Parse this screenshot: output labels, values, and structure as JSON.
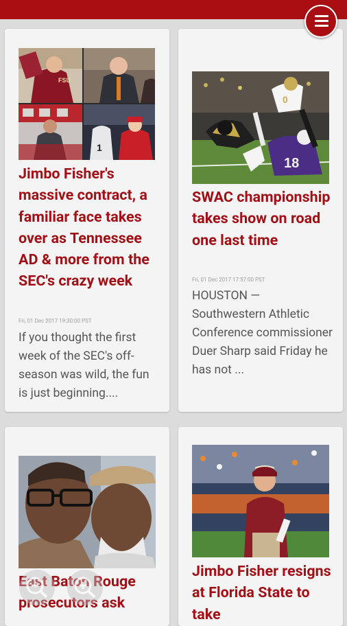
{
  "header": {
    "menu_icon": "hamburger-icon",
    "accent_color": "#a90f12"
  },
  "cards": [
    {
      "headline": "Jimbo Fisher's massive contract, a familiar face takes over as Tennessee AD & more from the SEC's crazy week",
      "date": "Fri, 01 Dec 2017 19:30:00 PST",
      "summary": "If you thought the first week of the SEC's off-season was wild, the fun is just beginning....",
      "image_badge": "FSU"
    },
    {
      "headline": "SWAC championship takes show on road one last time",
      "date": "Fri, 01 Dec 2017 17:57:00 PST",
      "summary": "HOUSTON — Southwestern Athletic Conference commissioner Duer Sharp said Friday he has not ...",
      "image_jersey": "18"
    },
    {
      "headline": "East Baton Rouge prosecutors ask"
    },
    {
      "headline": "Jimbo Fisher resigns at Florida State to take"
    }
  ],
  "overlay": {
    "zoom_in_icon": "zoom-in-icon",
    "zoom_out_icon": "zoom-out-icon"
  }
}
